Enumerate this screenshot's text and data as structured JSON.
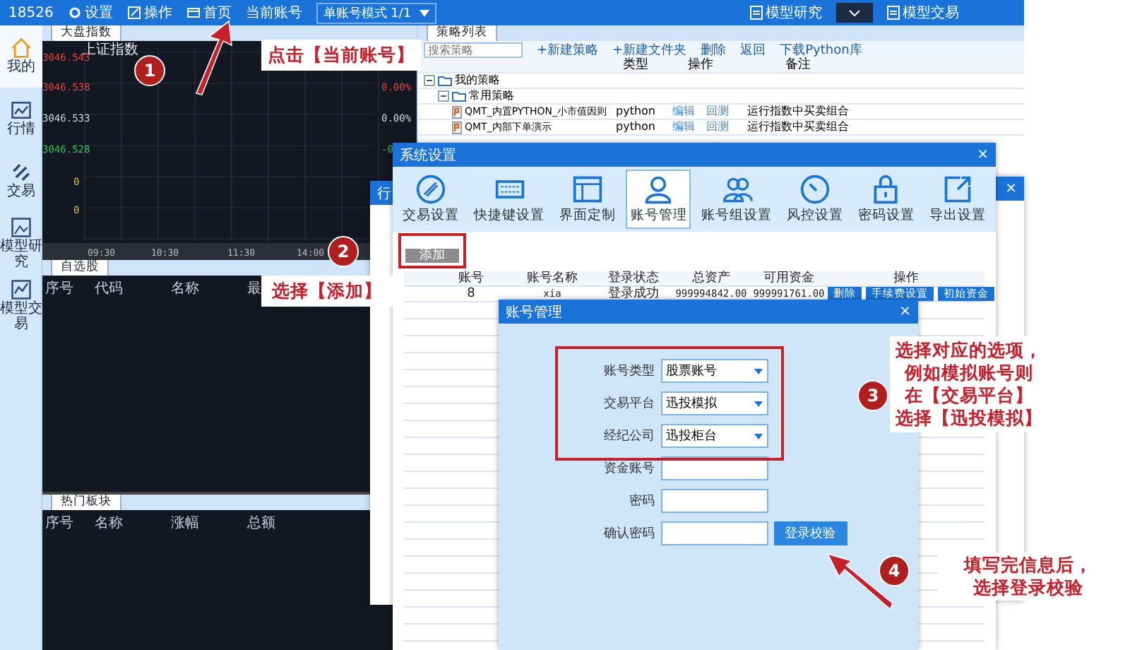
{
  "top_bar": {
    "account": "18526",
    "menu": [
      {
        "label": "设置"
      },
      {
        "label": "操作"
      },
      {
        "label": "首页"
      }
    ],
    "current_account_label": "当前账号",
    "account_mode": "单账号模式 1/1",
    "right_tabs": [
      {
        "label": "模型研究"
      },
      {
        "label": "模型交易"
      }
    ],
    "dropdown_active": true
  },
  "sidebar": {
    "items": [
      {
        "label": "我的",
        "selected": true
      },
      {
        "label": "行情",
        "selected": false
      },
      {
        "label": "交易",
        "selected": false
      },
      {
        "label": "模型研究",
        "selected": false
      },
      {
        "label": "模型交易",
        "selected": false
      }
    ]
  },
  "index_panel": {
    "tab": "大盘指数",
    "chart_title": "上证指数",
    "left_labels": [
      {
        "text": "3046.543",
        "color": "#e04848"
      },
      {
        "text": "3046.538",
        "color": "#e04848"
      },
      {
        "text": "3046.533",
        "color": "#d8d8d8"
      },
      {
        "text": "3046.528",
        "color": "#3cc060"
      },
      {
        "text": "0",
        "color": "#d8c040"
      },
      {
        "text": "0",
        "color": "#d8c040"
      }
    ],
    "right_labels": [
      {
        "text": "0.00%",
        "color": "#e04848"
      },
      {
        "text": "0.00%",
        "color": "#d8d8d8"
      },
      {
        "text": "-0",
        "color": "#3cc060"
      }
    ],
    "time_labels": [
      "09:30",
      "10:30",
      "11:30",
      "14:00"
    ]
  },
  "watchlist": {
    "tab": "自选股",
    "columns": [
      "序号",
      "代码",
      "名称",
      "最"
    ]
  },
  "hot_sectors": {
    "tab": "热门板块",
    "columns": [
      "序号",
      "名称",
      "涨幅",
      "总额"
    ]
  },
  "strategy_panel": {
    "tab": "策略列表",
    "search_placeholder": "搜索策略",
    "actions": [
      "+新建策略",
      "+新建文件夹",
      "删除",
      "返回",
      "下载Python库"
    ],
    "columns": [
      "类型",
      "操作",
      "备注"
    ],
    "tree": [
      {
        "label": "我的策略",
        "expanded": true,
        "children": [
          {
            "label": "常用策略",
            "expanded": true,
            "children": [
              {
                "label": "QMT_内置PYTHON_小市值因则",
                "type": "python",
                "actions": [
                  "编辑",
                  "回测"
                ],
                "note": "运行指数中买卖组合"
              },
              {
                "label": "QMT_内部下单演示",
                "type": "python",
                "actions": [
                  "编辑",
                  "回测"
                ],
                "note": "运行指数中买卖组合"
              }
            ]
          }
        ]
      }
    ]
  },
  "background_window": {
    "title": "行"
  },
  "partial_window": {
    "close": "×"
  },
  "system_settings": {
    "title": "系统设置",
    "close": "×",
    "tabs": [
      {
        "label": "交易设置",
        "selected": false
      },
      {
        "label": "快捷键设置",
        "selected": false
      },
      {
        "label": "界面定制",
        "selected": false
      },
      {
        "label": "账号管理",
        "selected": true
      },
      {
        "label": "账号组设置",
        "selected": false
      },
      {
        "label": "风控设置",
        "selected": false
      },
      {
        "label": "密码设置",
        "selected": false
      },
      {
        "label": "导出设置",
        "selected": false
      }
    ],
    "add_button": "添加",
    "columns": [
      "账号",
      "账号名称",
      "登录状态",
      "总资产",
      "可用资金",
      "操作"
    ],
    "rows": [
      {
        "cells": [
          "8",
          "xia",
          "登录成功",
          "999994842.00",
          "999991761.00"
        ],
        "actions": [
          "删除",
          "手续费设置",
          "初始资金"
        ]
      }
    ]
  },
  "account_dialog": {
    "title": "账号管理",
    "close": "×",
    "fields": [
      {
        "label": "账号类型",
        "kind": "select",
        "value": "股票账号"
      },
      {
        "label": "交易平台",
        "kind": "select",
        "value": "迅投模拟"
      },
      {
        "label": "经纪公司",
        "kind": "select",
        "value": "迅投柜台"
      },
      {
        "label": "资金账号",
        "kind": "input"
      },
      {
        "label": "密码",
        "kind": "input"
      },
      {
        "label": "确认密码",
        "kind": "input"
      }
    ],
    "verify_button": "登录校验"
  },
  "annotations": [
    {
      "number": "1",
      "lines": [
        "点击【当前账号】"
      ]
    },
    {
      "number": "2",
      "lines": [
        "选择【添加】"
      ]
    },
    {
      "number": "3",
      "lines": [
        "选择对应的选项，",
        "例如模拟账号则",
        "在【交易平台】",
        "选择【迅投模拟】"
      ]
    },
    {
      "number": "4",
      "lines": [
        "填写完信息后，",
        "选择登录校验"
      ]
    }
  ]
}
